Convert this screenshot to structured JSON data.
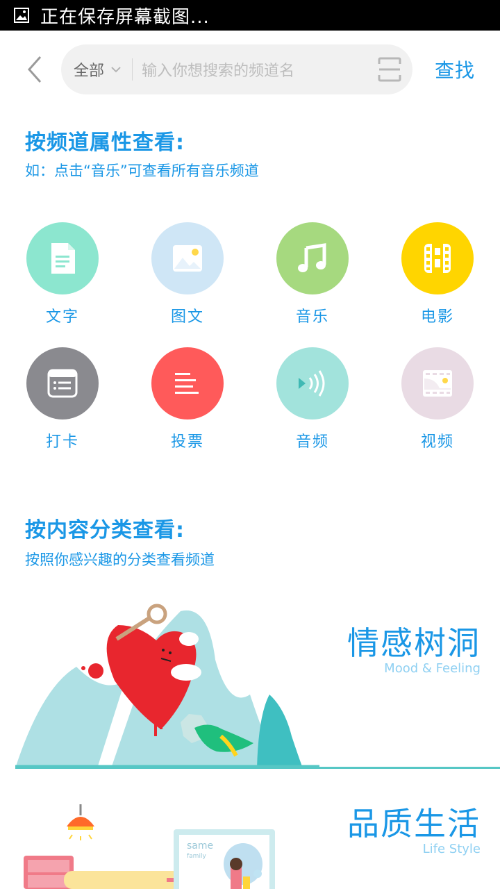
{
  "status_bar": {
    "text": "正在保存屏幕截图..."
  },
  "header": {
    "scope_label": "全部",
    "search_placeholder": "输入你想搜索的频道名",
    "find_label": "查找"
  },
  "by_attribute": {
    "title": "按频道属性查看:",
    "subtitle": "如：点击“音乐”可查看所有音乐频道",
    "items": [
      {
        "label": "文字",
        "icon": "document-icon",
        "color": "#8ce6cf"
      },
      {
        "label": "图文",
        "icon": "image-icon",
        "color": "#cfe6f6"
      },
      {
        "label": "音乐",
        "icon": "music-note-icon",
        "color": "#a6d97f"
      },
      {
        "label": "电影",
        "icon": "film-icon",
        "color": "#ffd500"
      },
      {
        "label": "打卡",
        "icon": "checkin-card-icon",
        "color": "#8a8a8f"
      },
      {
        "label": "投票",
        "icon": "vote-lines-icon",
        "color": "#ff5a5a"
      },
      {
        "label": "音频",
        "icon": "audio-wave-icon",
        "color": "#a2e3dc"
      },
      {
        "label": "视频",
        "icon": "video-icon",
        "color": "#e9dbe4"
      }
    ]
  },
  "by_content": {
    "title": "按内容分类查看:",
    "subtitle": "按照你感兴趣的分类查看频道",
    "categories": [
      {
        "title": "情感树洞",
        "subtitle": "Mood & Feeling"
      },
      {
        "title": "品质生活",
        "subtitle": "Life Style",
        "poster_text": "same",
        "poster_sub": "family"
      }
    ]
  },
  "colors": {
    "accent": "#1a97e6",
    "teal": "#56c7c5"
  }
}
